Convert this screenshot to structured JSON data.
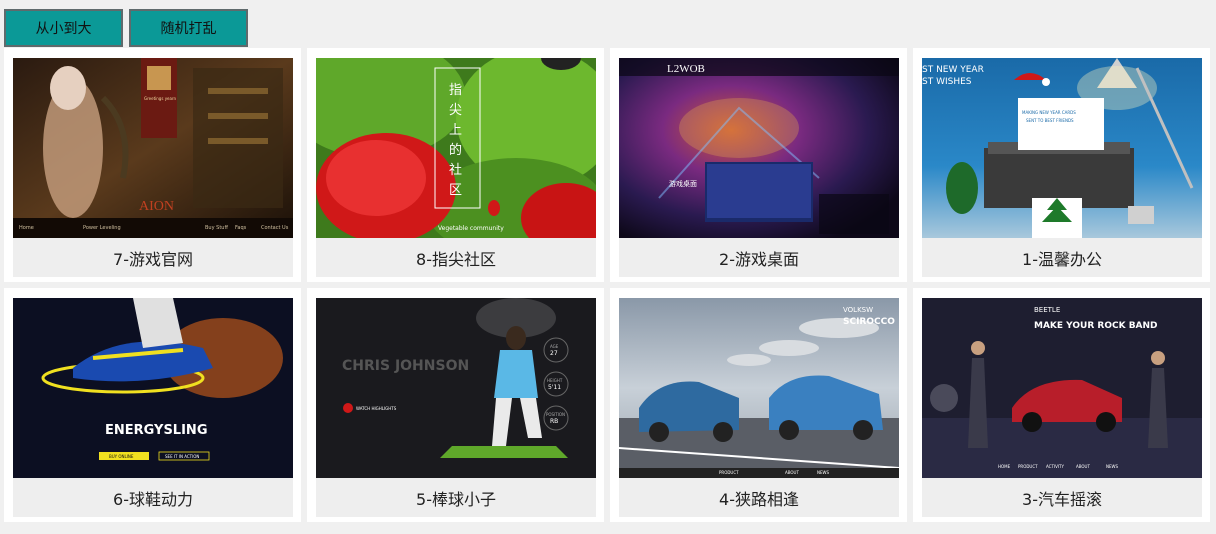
{
  "toolbar": {
    "sort_label": "从小到大",
    "shuffle_label": "随机打乱"
  },
  "cards": [
    {
      "caption": "7-游戏官网",
      "thumb_text": [
        "AION",
        "Home",
        "Power Leveling",
        "Buy Stuff",
        "Faqs",
        "Contact Us",
        "Greetings yearn"
      ]
    },
    {
      "caption": "8-指尖社区",
      "thumb_text": [
        "指",
        "尖",
        "上",
        "的",
        "社",
        "区",
        "Vegetable community"
      ]
    },
    {
      "caption": "2-游戏桌面",
      "thumb_text": [
        "L2WOB",
        "游戏桌面"
      ]
    },
    {
      "caption": "1-温馨办公",
      "thumb_text": [
        "ST NEW YEAR",
        "ST WISHES",
        "MAKING NEW YEAR CARDS",
        "SENT TO BEST FRIENDS"
      ]
    },
    {
      "caption": "6-球鞋动力",
      "thumb_text": [
        "ENERGYSLING",
        "BUY ONLINE",
        "SEE IT IN ACTION"
      ]
    },
    {
      "caption": "5-棒球小子",
      "thumb_text": [
        "CHRIS JOHNSON",
        "AGE",
        "27",
        "HEIGHT",
        "5'11",
        "POSITION",
        "RB",
        "WATCH HIGHLIGHTS"
      ]
    },
    {
      "caption": "4-狭路相逢",
      "thumb_text": [
        "VOLKSW",
        "SCIROCCO",
        "PRODUCT",
        "ABOUT",
        "NEWS"
      ]
    },
    {
      "caption": "3-汽车摇滚",
      "thumb_text": [
        "BEETLE",
        "MAKE YOUR ROCK BAND",
        "HOME",
        "PRODUCT",
        "ACTIVITY",
        "ABOUT",
        "NEWS"
      ]
    }
  ]
}
